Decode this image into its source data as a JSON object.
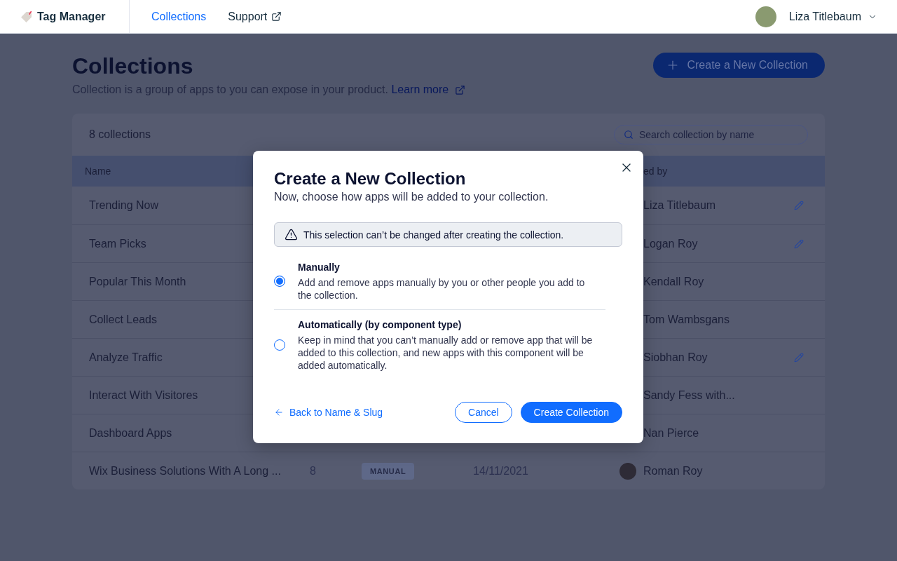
{
  "topbar": {
    "app_name": "Tag Manager",
    "nav": [
      {
        "label": "Collections",
        "selected": true,
        "external": false
      },
      {
        "label": "Support",
        "selected": false,
        "external": true
      }
    ],
    "user": {
      "name": "Liza Titlebaum"
    }
  },
  "page": {
    "title": "Collections",
    "description": "Collection is a group of apps to you can expose in your product.",
    "learn_more": "Learn more",
    "create_button": "Create a New Collection"
  },
  "table": {
    "count": "8 collections",
    "search": {
      "placeholder": "Search collection by name"
    },
    "columns": [
      {
        "label": "Name"
      },
      {
        "label": "ed by"
      }
    ],
    "rows": [
      {
        "name": "Trending Now",
        "created_by": "Liza Titlebaum",
        "avatar": false,
        "editable": true
      },
      {
        "name": "Team Picks",
        "created_by": "Logan Roy",
        "avatar": false,
        "editable": true
      },
      {
        "name": "Popular This Month",
        "created_by": "Kendall Roy",
        "avatar": false,
        "editable": false
      },
      {
        "name": "Collect Leads",
        "created_by": "Tom Wambsgans",
        "avatar": false,
        "editable": false
      },
      {
        "name": "Analyze Traffic",
        "created_by": "Siobhan Roy",
        "avatar": false,
        "editable": true
      },
      {
        "name": "Interact With Visitores",
        "created_by": "Sandy Fess with...",
        "avatar": false,
        "editable": false
      },
      {
        "name": "Dashboard Apps",
        "created_by": "Nan Pierce",
        "avatar": false,
        "editable": false
      },
      {
        "name": "Wix Business Solutions With A Long ...",
        "column_2": "8",
        "column_3": "MANUAL",
        "column_4": "14/11/2021",
        "created_by": "Roman Roy",
        "avatar": true,
        "editable": false
      }
    ]
  },
  "dialog": {
    "title": "Create a New Collection",
    "subtitle": "Now, choose how apps will be added to your collection.",
    "warning": "This selection can’t be changed after creating the collection.",
    "options": [
      {
        "title": "Manually",
        "description": "Add and remove apps manually by you or other people you add to the collection.",
        "selected": true
      },
      {
        "title": "Automatically (by component type)",
        "description": "Keep in mind that you can’t manually add or remove app that will be added to this collection, and new apps with this component will be added automatically.",
        "selected": false
      }
    ],
    "back_link": "Back to Name & Slug",
    "buttons": [
      {
        "label": "Cancel",
        "kind": "secondary"
      },
      {
        "label": "Create Collection",
        "kind": "primary"
      }
    ]
  }
}
